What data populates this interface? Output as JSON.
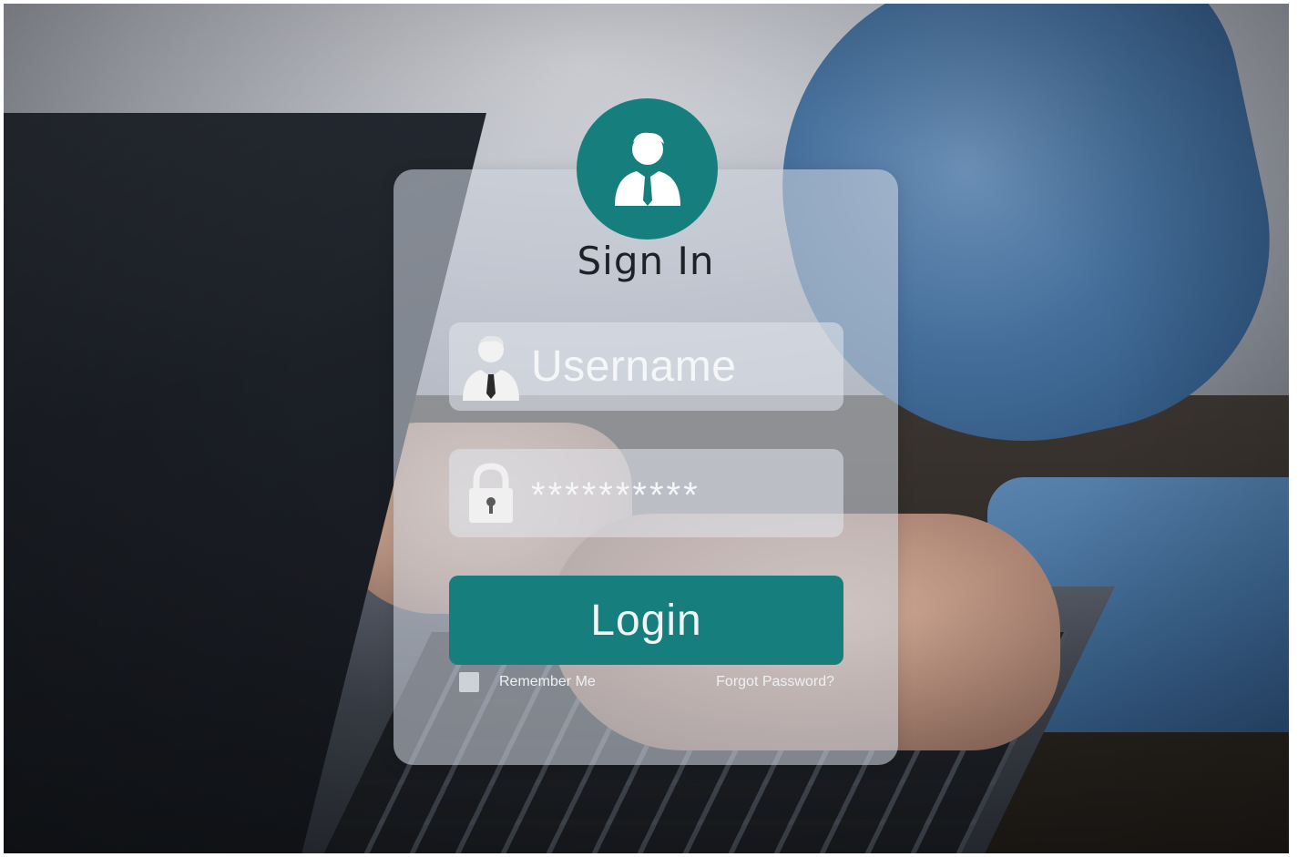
{
  "login_card": {
    "title": "Sign In",
    "username": {
      "placeholder": "Username",
      "icon": "user-icon"
    },
    "password": {
      "value": "**********",
      "icon": "lock-icon"
    },
    "login_label": "Login",
    "remember_label": "Remember Me",
    "forgot_label": "Forgot Password?",
    "avatar_icon": "user-avatar-icon"
  },
  "colors": {
    "accent": "#167f7d",
    "card": "#cdd4de",
    "title_text": "#1e2228"
  }
}
